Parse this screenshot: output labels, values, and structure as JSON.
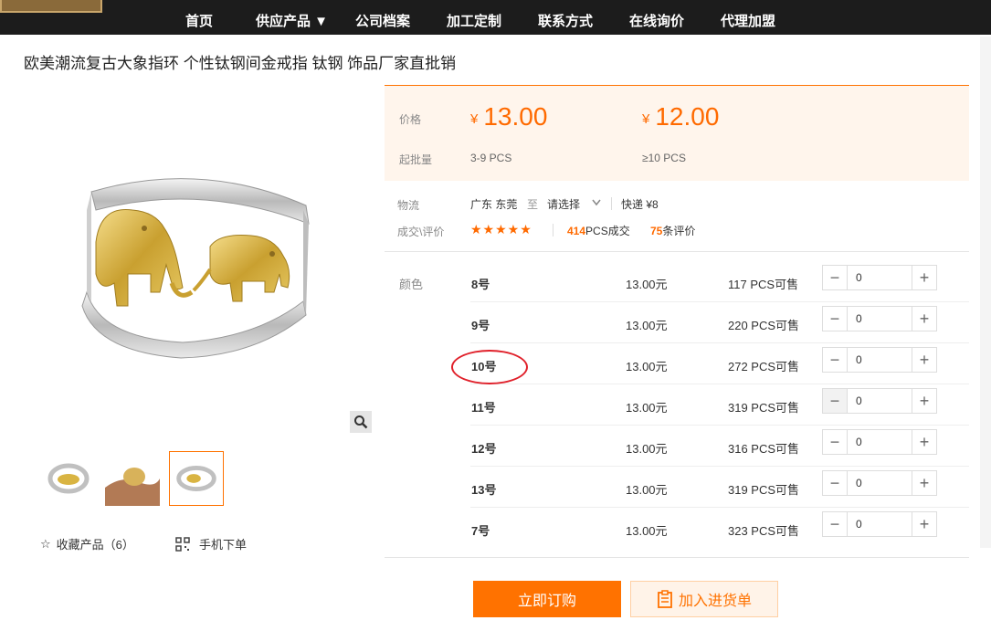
{
  "nav": {
    "items": [
      "首页",
      "供应产品 ▼",
      "公司档案",
      "加工定制",
      "联系方式",
      "在线询价",
      "代理加盟"
    ]
  },
  "product": {
    "title": "欧美潮流复古大象指环 个性钛钢间金戒指 钛钢 饰品厂家直批销"
  },
  "gallery": {
    "favorite_label": "收藏产品（6）",
    "mobile_order_label": "手机下单"
  },
  "pricing": {
    "price_label": "价格",
    "moq_label": "起批量",
    "currency": "¥",
    "tiers": [
      {
        "price": "13.00",
        "qty": "3-9  PCS"
      },
      {
        "price": "12.00",
        "qty": "≥10  PCS"
      }
    ]
  },
  "logistics": {
    "label": "物流",
    "from": "广东 东莞",
    "to_word": "至",
    "select_placeholder": "请选择",
    "express": "快递 ¥8"
  },
  "reviews": {
    "label": "成交\\评价",
    "rating": 5,
    "sold_count": "414",
    "sold_suffix": "PCS成交",
    "review_count": "75",
    "review_suffix": "条评价"
  },
  "variants": {
    "label": "颜色",
    "rows": [
      {
        "size": "8号",
        "price": "13.00元",
        "stock": "117 PCS可售",
        "qty": "0"
      },
      {
        "size": "9号",
        "price": "13.00元",
        "stock": "220 PCS可售",
        "qty": "0"
      },
      {
        "size": "10号",
        "price": "13.00元",
        "stock": "272 PCS可售",
        "qty": "0"
      },
      {
        "size": "11号",
        "price": "13.00元",
        "stock": "319 PCS可售",
        "qty": "0"
      },
      {
        "size": "12号",
        "price": "13.00元",
        "stock": "316 PCS可售",
        "qty": "0"
      },
      {
        "size": "13号",
        "price": "13.00元",
        "stock": "319 PCS可售",
        "qty": "0"
      },
      {
        "size": "7号",
        "price": "13.00元",
        "stock": "323 PCS可售",
        "qty": "0"
      }
    ]
  },
  "actions": {
    "order_label": "立即订购",
    "cart_label": "加入进货单"
  },
  "colors": {
    "accent": "#ff7200",
    "price": "#ff6a00",
    "annotation": "#e0202a"
  }
}
